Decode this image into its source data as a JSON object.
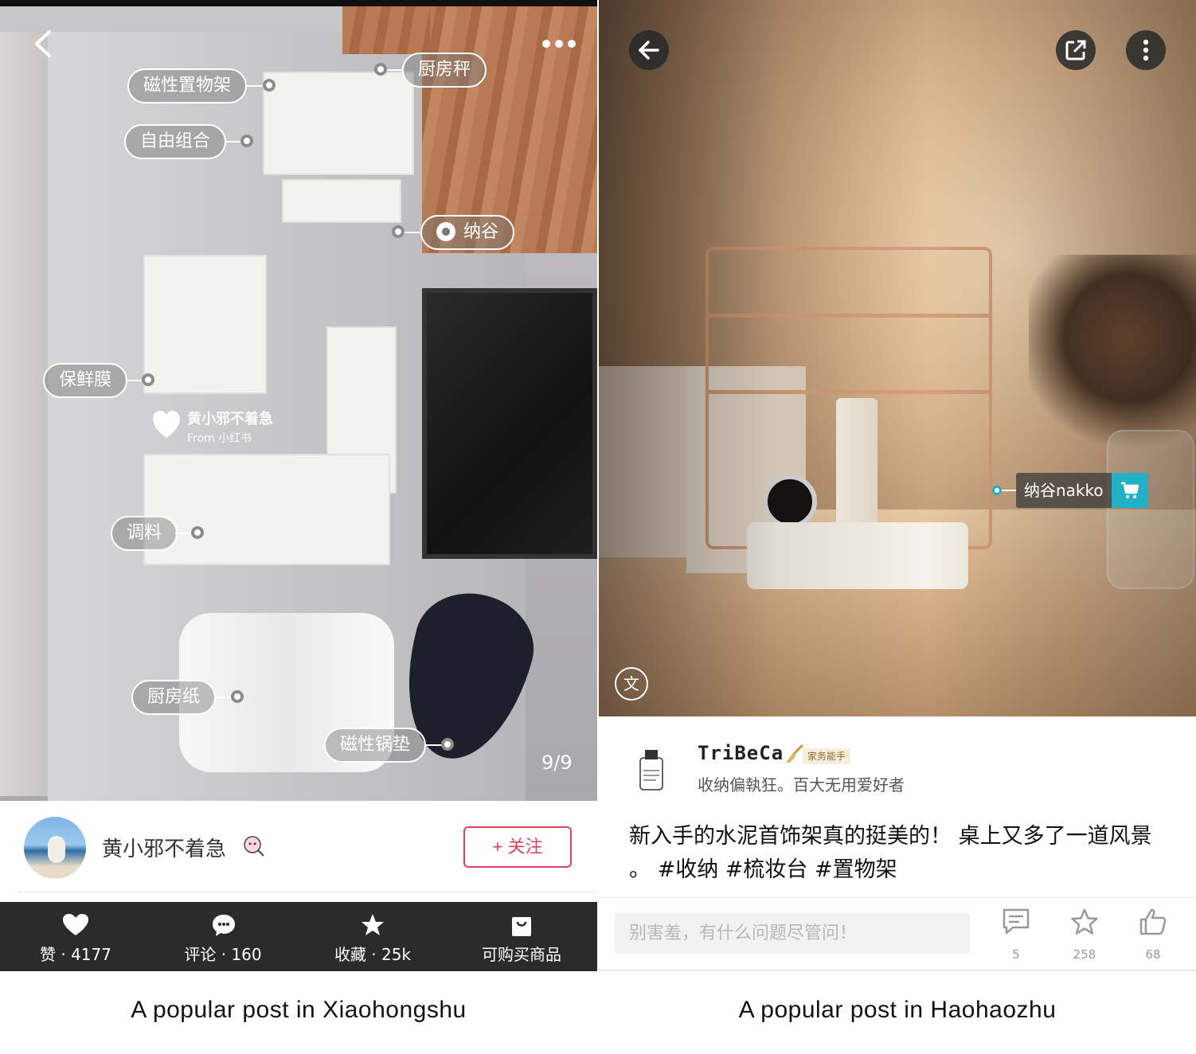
{
  "left": {
    "tags": {
      "magnetic_rack": "磁性置物架",
      "free_combo": "自由组合",
      "kitchen_scale": "厨房秤",
      "brand": "纳谷",
      "wrap": "保鲜膜",
      "seasoning": "调料",
      "paper": "厨房纸",
      "pot_mat": "磁性锅垫"
    },
    "watermark": {
      "name": "黄小邪不着急",
      "from": "From 小红书"
    },
    "page_counter": "9/9",
    "profile": {
      "username": "黄小邪不着急",
      "follow_label": "+ 关注"
    },
    "actions": {
      "like": "赞 · 4177",
      "comment": "评论 · 160",
      "collect": "收藏 · 25k",
      "shop": "可购买商品"
    },
    "caption": "A popular post in Xiaohongshu",
    "colors": {
      "accent": "#e0415b",
      "action_bar": "#2b2b2b"
    }
  },
  "right": {
    "product_tag": "纳谷nakko",
    "text_badge": "文",
    "author": {
      "name": "TriBeCa",
      "badge": "家务能手",
      "bio": "收纳偏執狂。百大无用爱好者"
    },
    "post_text": "新入手的水泥首饰架真的挺美的！ 桌上又多了一道风景 。 #收纳 #梳妆台 #置物架",
    "comment_placeholder": "别害羞，有什么问题尽管问！",
    "stats": {
      "comments": "5",
      "favorites": "258",
      "likes": "68"
    },
    "caption": "A popular post in Haohaozhu",
    "colors": {
      "cart_accent": "#21b0c6"
    }
  }
}
